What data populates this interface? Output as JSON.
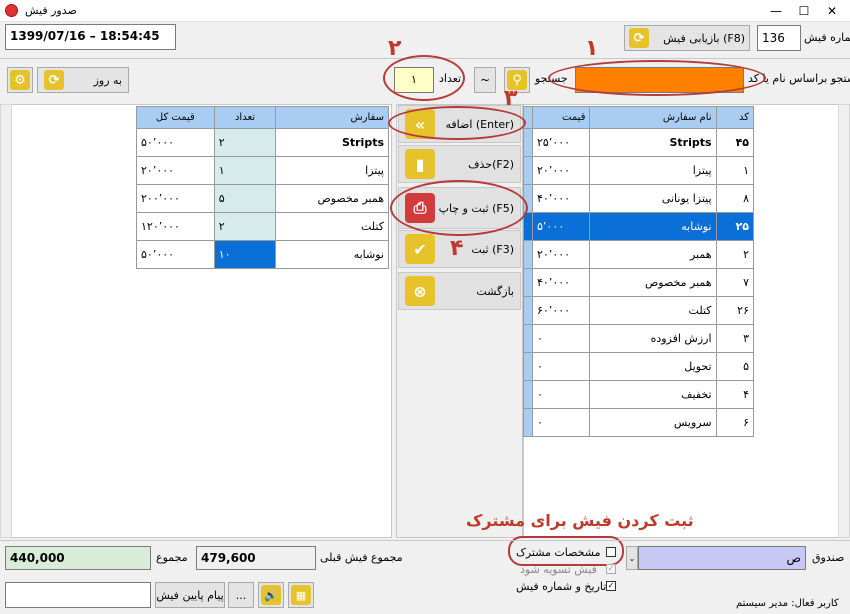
{
  "window": {
    "title": "صدور فیش",
    "minimize": "—",
    "maximize": "☐",
    "close": "✕"
  },
  "header": {
    "datetime": "1399/07/16 – 18:54:45",
    "recall_label": "بازیابی فیش (F8)",
    "receipt_number": "136",
    "receipt_number_label": "شماره فیش"
  },
  "toolbar": {
    "refresh_label": "به روز",
    "count_label": "تعداد",
    "count_value": "۱",
    "search_label": "جستجو",
    "tilde": "~",
    "search_by_label": "جستجو براساس نام یا کد"
  },
  "order_table": {
    "headers": [
      "سفارش",
      "تعداد",
      "قیمت کل"
    ],
    "rows": [
      {
        "name": "Stripts",
        "qty": "۲",
        "total": "۵۰٬۰۰۰"
      },
      {
        "name": "پیتزا",
        "qty": "۱",
        "total": "۲۰٬۰۰۰"
      },
      {
        "name": "همبر مخصوص",
        "qty": "۵",
        "total": "۲۰۰٬۰۰۰"
      },
      {
        "name": "کتلت",
        "qty": "۲",
        "total": "۱۲۰٬۰۰۰"
      },
      {
        "name": "نوشابه",
        "qty": "۱۰",
        "total": "۵۰٬۰۰۰"
      }
    ]
  },
  "actions": {
    "add": "اضافه (Enter)",
    "delete": "حذف(F2)",
    "save_print": "ثبت و چاپ (F5)",
    "save": "ثبت (F3)",
    "back": "بازگشت"
  },
  "menu_table": {
    "headers": [
      "کد",
      "نام سفارش",
      "قیمت"
    ],
    "rows": [
      {
        "code": "۴۵",
        "name": "Stripts",
        "price": "۲۵٬۰۰۰"
      },
      {
        "code": "۱",
        "name": "پیتزا",
        "price": "۲۰٬۰۰۰"
      },
      {
        "code": "۸",
        "name": "پیتزا یونانی",
        "price": "۴۰٬۰۰۰"
      },
      {
        "code": "۲۵",
        "name": "نوشابه",
        "price": "۵٬۰۰۰"
      },
      {
        "code": "۲",
        "name": "همبر",
        "price": "۲۰٬۰۰۰"
      },
      {
        "code": "۷",
        "name": "همبر مخصوص",
        "price": "۴۰٬۰۰۰"
      },
      {
        "code": "۲۶",
        "name": "کتلت",
        "price": "۶۰٬۰۰۰"
      },
      {
        "code": "۳",
        "name": "ارزش افزوده",
        "price": "۰"
      },
      {
        "code": "۵",
        "name": "تحویل",
        "price": "۰"
      },
      {
        "code": "۴",
        "name": "تخفیف",
        "price": "۰"
      },
      {
        "code": "۶",
        "name": "سرویس",
        "price": "۰"
      }
    ],
    "selected_index": 3
  },
  "annotations": {
    "n1": "۱",
    "n2": "۲",
    "n3": "۳",
    "n4": "۴",
    "caption": "ثبت کردن فیش برای مشترک"
  },
  "footer": {
    "total": "440,000",
    "total_label": "مجموع",
    "prev_total": "479,600",
    "prev_total_label": "مجموع فیش قبلی",
    "cashbox_label": "صندوق",
    "cashbox_value": "ص",
    "customer_spec": "مشخصات مشترک",
    "settle": "فیش تسویه شود",
    "date_number": "تاریخ و شماره فیش",
    "message_label": "پیام پایین فیش",
    "ellipsis": "...",
    "active_user": "کاربر فعال: مدیر سیستم"
  },
  "colors": {
    "accent": "#0a6fd6",
    "orange": "#ff8000",
    "header_blue": "#a9cdf2",
    "annot_red": "#c0392b"
  }
}
